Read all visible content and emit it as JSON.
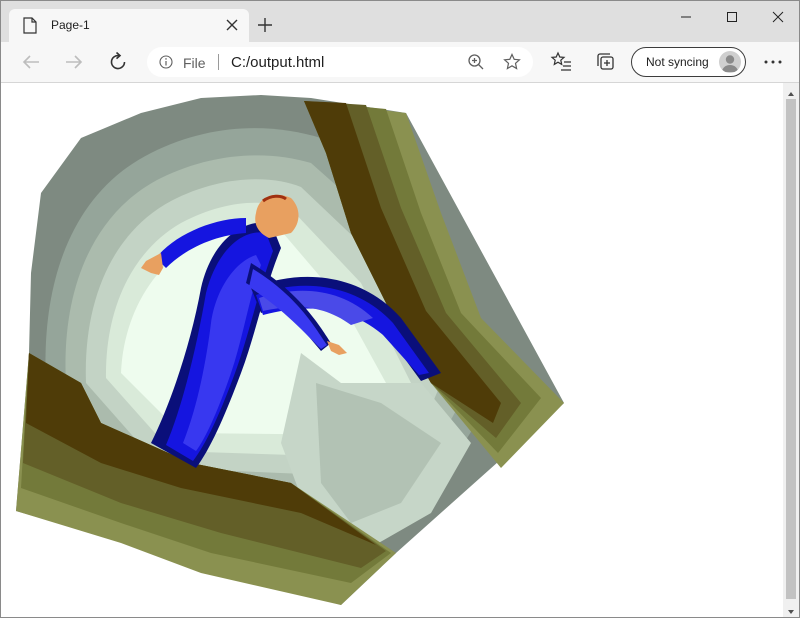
{
  "browser": {
    "tab": {
      "title": "Page-1",
      "icon": "page-icon"
    },
    "address": {
      "scheme_label": "File",
      "url": "C:/output.html"
    },
    "profile": {
      "label": "Not syncing"
    },
    "window_controls": [
      "minimize-icon",
      "maximize-icon",
      "close-icon"
    ]
  },
  "content": {
    "image": {
      "subject": "man-falling-into-crevasse",
      "colors": {
        "rock_olive": "#8a9150",
        "rock_dark": "#4f3c08",
        "cave_grey": "#7e8a81",
        "cave_light": "#eefcee",
        "suit_blue": "#1515e0",
        "suit_navy": "#0a0f7a",
        "skin": "#e8a060"
      }
    }
  }
}
